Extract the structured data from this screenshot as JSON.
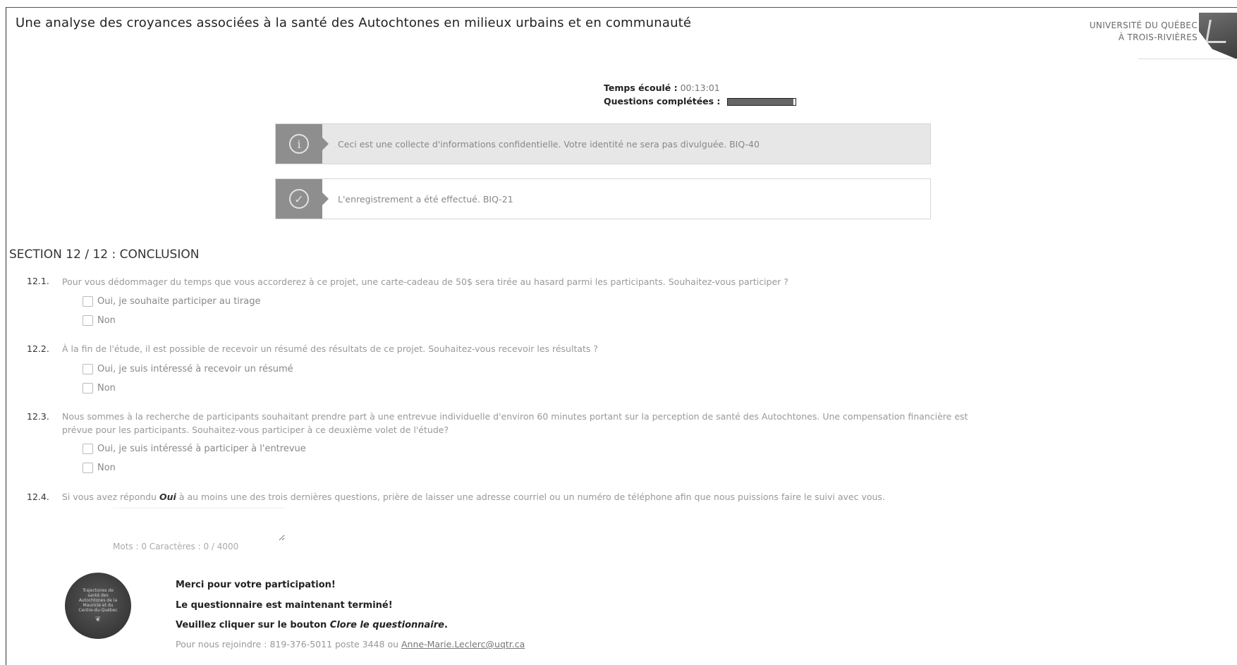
{
  "header": {
    "title": "Une analyse des croyances associées à la santé des Autochtones en milieux urbains et en communauté",
    "logo_line1": "UNIVERSITÉ DU QUÉBEC",
    "logo_line2": "À TROIS-RIVIÈRES"
  },
  "progress": {
    "elapsed_label": "Temps écoulé :",
    "elapsed_value": "00:13:01",
    "completed_label": "Questions complétées :",
    "completed_fraction": 0.96
  },
  "alerts": {
    "info": {
      "icon": "info-icon",
      "text": "Ceci est une collecte d'informations confidentielle. Votre identité ne sera pas divulguée. BIQ-40"
    },
    "success": {
      "icon": "check-circle-icon",
      "text": "L'enregistrement a été effectué. BIQ-21"
    }
  },
  "section": {
    "title": "SECTION 12 / 12 : CONCLUSION"
  },
  "questions": [
    {
      "number": "12.1.",
      "text": "Pour vous dédommager du temps que vous accorderez à ce projet, une carte-cadeau de 50$ sera tirée au hasard parmi les participants. Souhaitez-vous participer ?",
      "options": [
        "Oui, je souhaite participer au tirage",
        "Non"
      ]
    },
    {
      "number": "12.2.",
      "text": "À la fin de l'étude, il est possible de recevoir un résumé des résultats de ce projet. Souhaitez-vous recevoir les résultats ?",
      "options": [
        "Oui, je suis intéressé à recevoir un résumé",
        "Non"
      ]
    },
    {
      "number": "12.3.",
      "text": "Nous sommes à la recherche de participants souhaitant prendre part à une entrevue individuelle d'environ 60 minutes portant sur la perception de santé des Autochtones. Une compensation financière est prévue pour les participants. Souhaitez-vous participer à ce deuxième volet de l'étude?",
      "options": [
        "Oui, je suis intéressé à participer à l'entrevue",
        "Non"
      ]
    },
    {
      "number": "12.4.",
      "text_before": "Si vous avez répondu",
      "text_bold": "Oui",
      "text_after": "à au moins une des trois dernières questions, prière de laisser une adresse courriel ou un numéro de téléphone afin que nous puissions faire le suivi avec vous.",
      "textarea_value": "",
      "counter": "Mots : 0 Caractères : 0 / 4000"
    }
  ],
  "closing": {
    "badge_text": "Trajectoires de santé des Autochtones de la Mauricie et du Centre-du-Québec",
    "thanks1": "Merci pour votre participation!",
    "thanks2": "Le questionnaire est maintenant terminé!",
    "thanks3_before": "Veuillez cliquer sur le bouton",
    "thanks3_em": "Clore le questionnaire",
    "thanks3_after": ".",
    "contact_label": "Pour nous rejoindre :  819-376-5011 poste 3448 ou",
    "contact_email": "Anne-Marie.Leclerc@uqtr.ca"
  }
}
